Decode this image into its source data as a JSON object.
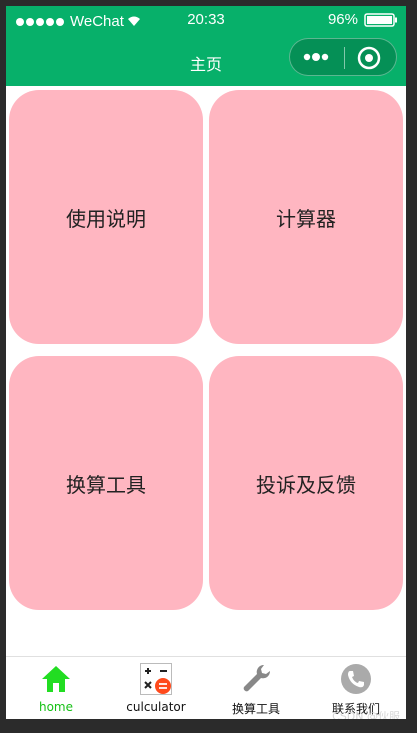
{
  "status_bar": {
    "carrier": "WeChat",
    "time": "20:33",
    "battery": "96%"
  },
  "nav": {
    "title": "主页"
  },
  "cards": [
    {
      "label": "使用说明"
    },
    {
      "label": "计算器"
    },
    {
      "label": "换算工具"
    },
    {
      "label": "投诉及反馈"
    }
  ],
  "tab_bar": {
    "items": [
      {
        "label": "home",
        "icon": "home-icon",
        "active": true
      },
      {
        "label": "culculator",
        "icon": "calculator-icon",
        "active": false
      },
      {
        "label": "换算工具",
        "icon": "wrench-icon",
        "active": false
      },
      {
        "label": "联系我们",
        "icon": "phone-icon",
        "active": false
      }
    ]
  },
  "watermark": "CSDN @伙服",
  "colors": {
    "brand": "#07b06a",
    "card": "#ffb6c1",
    "active_tab": "#15c015"
  }
}
